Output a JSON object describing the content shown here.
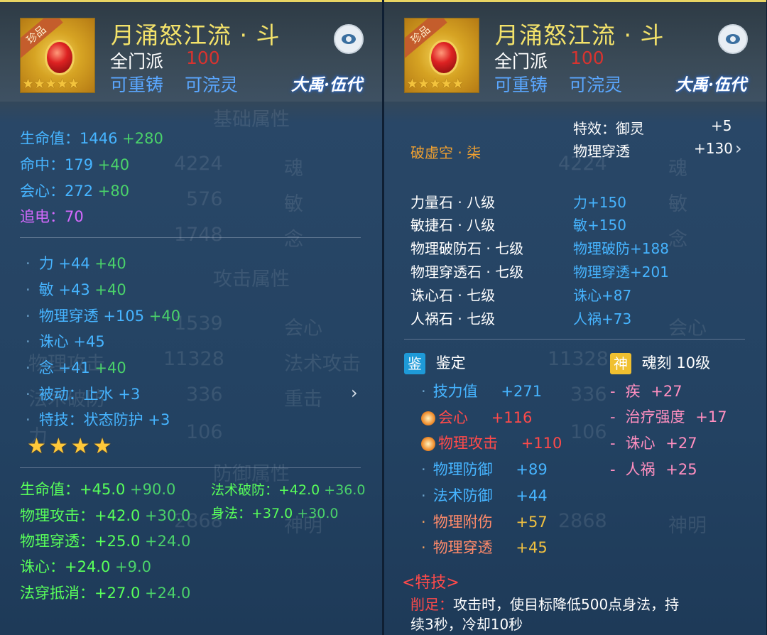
{
  "common": {
    "item_name": "月涌怒江流 · 斗",
    "badge": "珍品",
    "stars_small": "★★★★★",
    "sect": "全门派",
    "level": "100",
    "recast": "可重铸",
    "refine": "可浣灵",
    "server": "大禹·伍代",
    "colors": {
      "title": "#f3e26a",
      "blue": "#46b4ff",
      "green": "#4ad26a",
      "purple": "#d56aff",
      "orange": "#f0a030",
      "pink": "#ff8fc0",
      "red": "#ff4a4a"
    }
  },
  "left": {
    "ghost": [
      "基础属性",
      "4224",
      "魂",
      "576",
      "敏",
      "1748",
      "念",
      "攻击属性",
      "1539",
      "会心",
      "物理攻击",
      "11328",
      "法术攻击",
      "法术破防",
      "336",
      "重击",
      "力",
      "106",
      "防御属性",
      "2868",
      "神明"
    ],
    "base_stats": [
      {
        "label": "生命值：",
        "value": "1446",
        "bonus": "+280",
        "color": "blue"
      },
      {
        "label": "命中：",
        "value": "179",
        "bonus": "+40",
        "color": "blue"
      },
      {
        "label": "会心：",
        "value": "272",
        "bonus": "+80",
        "color": "blue"
      },
      {
        "label": "追电：",
        "value": "70",
        "bonus": "",
        "color": "purple"
      }
    ],
    "attrs": [
      {
        "label": "力",
        "value": "+44",
        "bonus": "+40"
      },
      {
        "label": "敏",
        "value": "+43",
        "bonus": "+40"
      },
      {
        "label": "物理穿透",
        "value": "+105",
        "bonus": "+40"
      },
      {
        "label": "诛心",
        "value": "+45",
        "bonus": ""
      },
      {
        "label": "念",
        "value": "+41",
        "bonus": "+40"
      },
      {
        "label": "被动：止水",
        "value": "+3",
        "bonus": ""
      },
      {
        "label": "特技：状态防护",
        "value": "+3",
        "bonus": ""
      }
    ],
    "stars_big": "★★★★",
    "green_stats": [
      {
        "label": "生命值：",
        "v1": "+45.0",
        "v2": "+90.0"
      },
      {
        "label": "法术破防：",
        "v1": "+42.0",
        "v2": "+36.0"
      },
      {
        "label": "物理攻击：",
        "v1": "+42.0",
        "v2": "+30.0"
      },
      {
        "label": "身法：",
        "v1": "+37.0",
        "v2": "+30.0"
      },
      {
        "label": "物理穿透：",
        "v1": "+25.0",
        "v2": "+24.0"
      },
      {
        "label": "诛心：",
        "v1": "+24.0",
        "v2": "+9.0"
      },
      {
        "label": "法穿抵消：",
        "v1": "+27.0",
        "v2": "+24.0"
      }
    ]
  },
  "right": {
    "effect_label": "特效：御灵",
    "effect_value": "+5",
    "pen_label": "物理穿透",
    "pen_value": "+130",
    "set_name": "破虚空 · 柒",
    "gems": [
      {
        "name": "力量石 · 八级",
        "effect": "力+150"
      },
      {
        "name": "敏捷石 · 八级",
        "effect": "敏+150"
      },
      {
        "name": "物理破防石 · 七级",
        "effect": "物理破防+188"
      },
      {
        "name": "物理穿透石 · 七级",
        "effect": "物理穿透+201"
      },
      {
        "name": "诛心石 · 七级",
        "effect": "诛心+87"
      },
      {
        "name": "人祸石 · 七级",
        "effect": "人祸+73"
      }
    ],
    "identify_badge": "鉴",
    "identify_label": "鉴定",
    "soul_badge": "神",
    "soul_label": "魂刻  10级",
    "identify_stats": [
      {
        "label": "技力值",
        "value": "+271",
        "kind": "normal"
      },
      {
        "label": "会心",
        "value": "+116",
        "kind": "special"
      },
      {
        "label": "物理攻击",
        "value": "+110",
        "kind": "special"
      },
      {
        "label": "物理防御",
        "value": "+89",
        "kind": "normal"
      },
      {
        "label": "法术防御",
        "value": "+44",
        "kind": "normal"
      },
      {
        "label": "物理附伤",
        "value": "+57",
        "kind": "orange"
      },
      {
        "label": "物理穿透",
        "value": "+45",
        "kind": "orange"
      }
    ],
    "soul_stats": [
      {
        "label": "疾",
        "value": "+27"
      },
      {
        "label": "治疗强度",
        "value": "+17"
      },
      {
        "label": "诛心",
        "value": "+27"
      },
      {
        "label": "人祸",
        "value": "+25"
      }
    ],
    "skill_header": "<特技>",
    "skill_name": "削足：",
    "skill_desc1": "攻击时，使目标降低500点身法，持",
    "skill_desc2": "续3秒，冷却10秒"
  }
}
